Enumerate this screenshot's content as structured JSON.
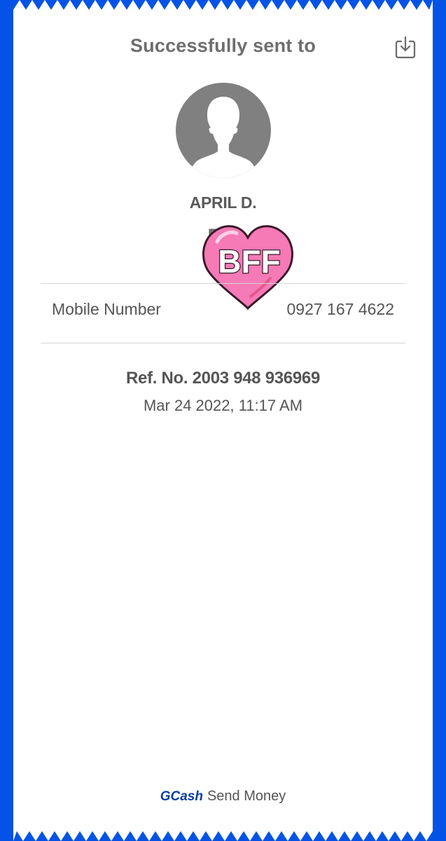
{
  "header": {
    "title": "Successfully sent to",
    "download_icon": "download-icon"
  },
  "recipient": {
    "avatar_icon": "user-silhouette-icon",
    "name": "APRIL D.",
    "amount_prefix_visible": "PH"
  },
  "sticker": {
    "text": "BFF",
    "icon": "heart-sticker-icon"
  },
  "details": {
    "mobile_label": "Mobile Number",
    "mobile_value": "0927 167 4622"
  },
  "reference": {
    "ref_no": "Ref. No. 2003 948 936969",
    "datetime": "Mar 24 2022, 11:17 AM"
  },
  "footer": {
    "brand": "GCash",
    "label": "Send Money"
  },
  "colors": {
    "background": "#0553e6",
    "receipt": "#ffffff",
    "text": "#555555",
    "brand": "#0b3e9c",
    "sticker_fill": "#f57ab6"
  }
}
